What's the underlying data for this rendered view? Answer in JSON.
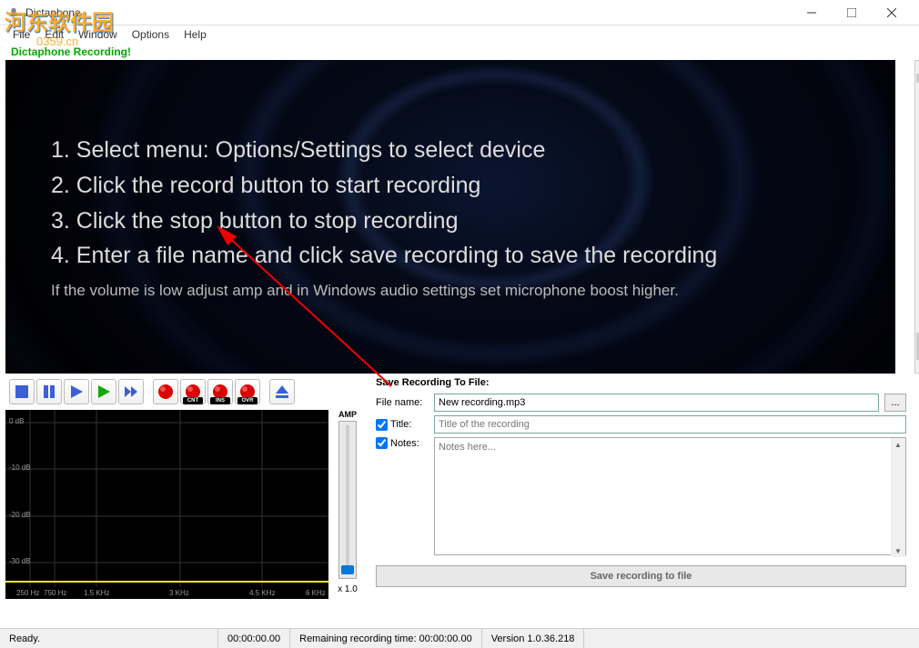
{
  "window": {
    "title": "Dictaphone"
  },
  "menubar": {
    "file": "File",
    "edit": "Edit",
    "window": "Window",
    "options": "Options",
    "help": "Help"
  },
  "watermark": {
    "main": "河东软件园",
    "url": "0359.cn"
  },
  "status_label": "Dictaphone Recording!",
  "instructions": {
    "l1": "1. Select menu: Options/Settings to select device",
    "l2": "2. Click the record button to start recording",
    "l3": "3. Click the stop button to stop recording",
    "l4": "4. Enter a file name and click save recording to save the recording",
    "sub": "If the volume is low adjust amp and in Windows audio settings set microphone boost higher."
  },
  "transport": {
    "cnt": "CNT",
    "ins": "INS",
    "ovr": "OVR"
  },
  "save": {
    "header": "Save Recording To File:",
    "filename_label": "File name:",
    "filename_value": "New recording.mp3",
    "title_label": "Title:",
    "title_placeholder": "Title of the recording",
    "notes_label": "Notes:",
    "notes_placeholder": "Notes here...",
    "browse": "...",
    "save_btn": "Save recording to file"
  },
  "spectrum": {
    "db": [
      "0 dB",
      "-10 dB",
      "-20 dB",
      "-30 dB"
    ],
    "hz": [
      "250 Hz",
      "750 Hz",
      "1.5 KHz",
      "3 KHz",
      "4.5 KHz",
      "6 KHz"
    ]
  },
  "amp": {
    "label": "AMP",
    "value": "x 1.0"
  },
  "statusbar": {
    "ready": "Ready.",
    "time": "00:00:00.00",
    "remaining": "Remaining recording time: 00:00:00.00",
    "version": "Version 1.0.36.218"
  }
}
